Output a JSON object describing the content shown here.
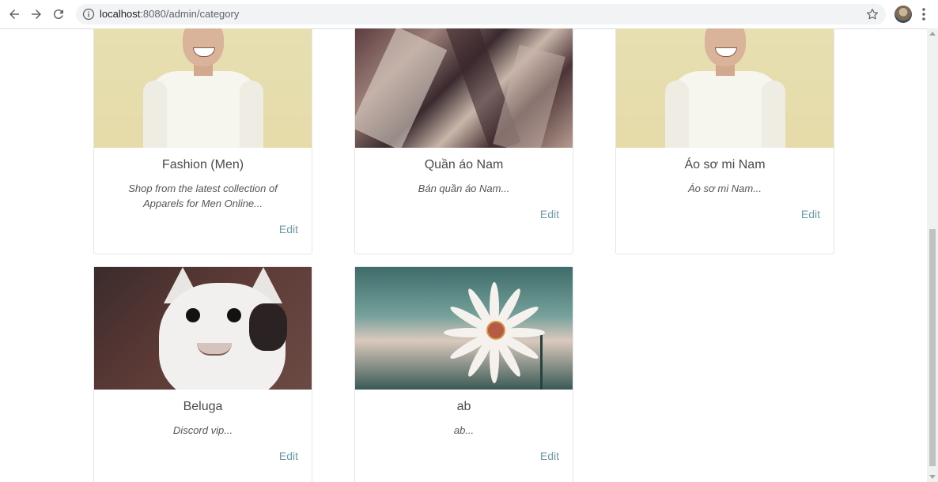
{
  "browser": {
    "url_host": "localhost",
    "url_rest": ":8080/admin/category"
  },
  "colors": {
    "edit_link": "#6b9aa5",
    "title_text": "#4a4a4a",
    "card_border": "#e5e5e5"
  },
  "cards": [
    {
      "title": "Fashion (Men)",
      "description": "Shop from the latest collection of Apparels for Men Online...",
      "edit_label": "Edit",
      "image_icon": "man-in-white-sweater-image"
    },
    {
      "title": "Quần áo Nam",
      "description": "Bán quần áo Nam...",
      "edit_label": "Edit",
      "image_icon": "anime-artwork-image"
    },
    {
      "title": "Áo sơ mi Nam",
      "description": "Áo sơ mi Nam...",
      "edit_label": "Edit",
      "image_icon": "man-in-white-sweater-image"
    },
    {
      "title": "Beluga",
      "description": "Discord vip...",
      "edit_label": "Edit",
      "image_icon": "cat-meme-image"
    },
    {
      "title": "ab",
      "description": "ab...",
      "edit_label": "Edit",
      "image_icon": "daisy-flower-image"
    }
  ]
}
